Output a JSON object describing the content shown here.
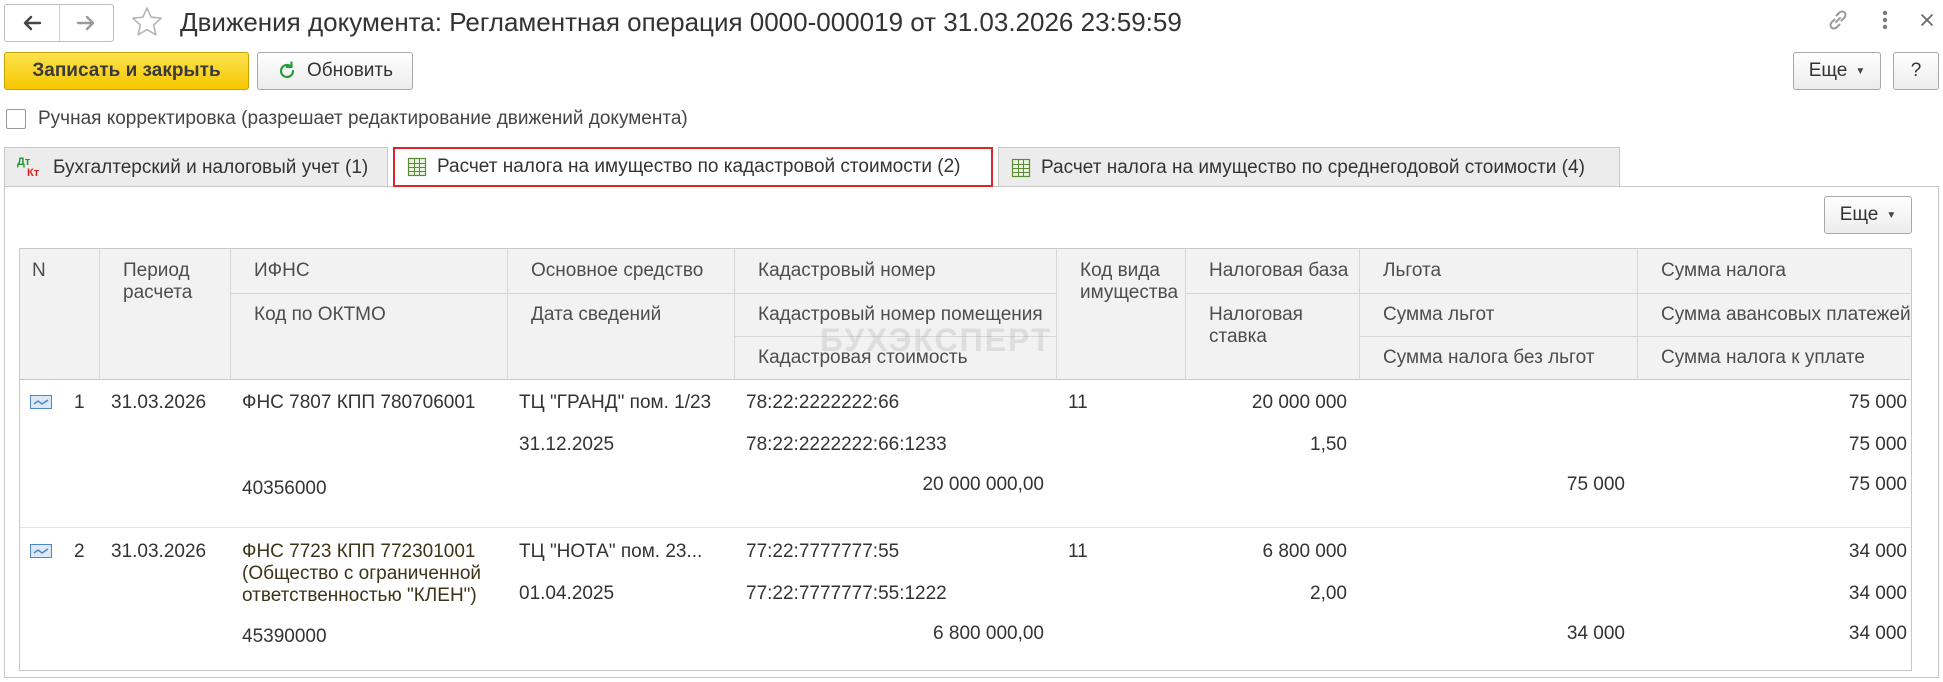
{
  "window": {
    "title": "Движения документа: Регламентная операция 0000-000019 от 31.03.2026 23:59:59"
  },
  "toolbar": {
    "save_close_label": "Записать и закрыть",
    "refresh_label": "Обновить",
    "more_label": "Еще",
    "help_label": "?"
  },
  "manual_correction": {
    "label": "Ручная корректировка (разрешает редактирование движений документа)",
    "checked": false
  },
  "tabs": [
    {
      "label": "Бухгалтерский и налоговый учет (1)",
      "icon": "dt-kt-icon"
    },
    {
      "label": "Расчет налога на имущество по кадастровой стоимости (2)",
      "icon": "register-grid-icon",
      "active": true
    },
    {
      "label": "Расчет налога на имущество по среднегодовой стоимости (4)",
      "icon": "register-grid-icon"
    }
  ],
  "panel": {
    "more_label": "Еще"
  },
  "watermark": "БУХЭКСПЕРТ",
  "table": {
    "headers": {
      "n": "N",
      "period": [
        "Период",
        "расчета"
      ],
      "ifns": "ИФНС",
      "oktmo": "Код по ОКТМО",
      "asset": "Основное средство",
      "info_date": "Дата сведений",
      "cad_number": "Кадастровый номер",
      "cad_room": "Кадастровый номер помещения",
      "cad_value": "Кадастровая стоимость",
      "asset_kind": [
        "Код вида",
        "имущества"
      ],
      "tax_base": "Налоговая база",
      "tax_rate": [
        "Налоговая",
        "ставка"
      ],
      "benefit": "Льгота",
      "benefit_sum": "Сумма льгот",
      "tax_no_benefit": "Сумма налога без льгот",
      "tax_sum": "Сумма налога",
      "advance_sum": "Сумма авансовых платежей",
      "tax_payable": "Сумма налога к уплате"
    },
    "rows": [
      {
        "n": "1",
        "period": "31.03.2026",
        "ifns": [
          "ФНС 7807 КПП 780706001"
        ],
        "oktmo": "40356000",
        "asset": "ТЦ \"ГРАНД\" пом. 1/23",
        "info_date": "31.12.2025",
        "cad_number": "78:22:2222222:66",
        "cad_room": "78:22:2222222:66:1233",
        "cad_value": "20 000 000,00",
        "asset_kind": "11",
        "tax_base": "20 000 000",
        "tax_rate": "1,50",
        "tax_no_benefit": "75 000",
        "tax_sum": "75 000",
        "advance_sum": "75 000",
        "tax_payable": "75 000"
      },
      {
        "n": "2",
        "period": "31.03.2026",
        "ifns": [
          "ФНС 7723 КПП 772301001",
          "(Общество с ограниченной",
          "ответственностью \"КЛЕН\")"
        ],
        "oktmo": "45390000",
        "asset": "ТЦ \"НОТА\" пом. 23...",
        "info_date": "01.04.2025",
        "cad_number": "77:22:7777777:55",
        "cad_room": "77:22:7777777:55:1222",
        "cad_value": "6 800 000,00",
        "asset_kind": "11",
        "tax_base": "6 800 000",
        "tax_rate": "2,00",
        "tax_no_benefit": "34 000",
        "tax_sum": "34 000",
        "advance_sum": "34 000",
        "tax_payable": "34 000"
      }
    ]
  },
  "colors": {
    "primary_button": "#f6c700",
    "active_tab_border": "#e0242a",
    "header_bg": "#f2f2f2"
  }
}
